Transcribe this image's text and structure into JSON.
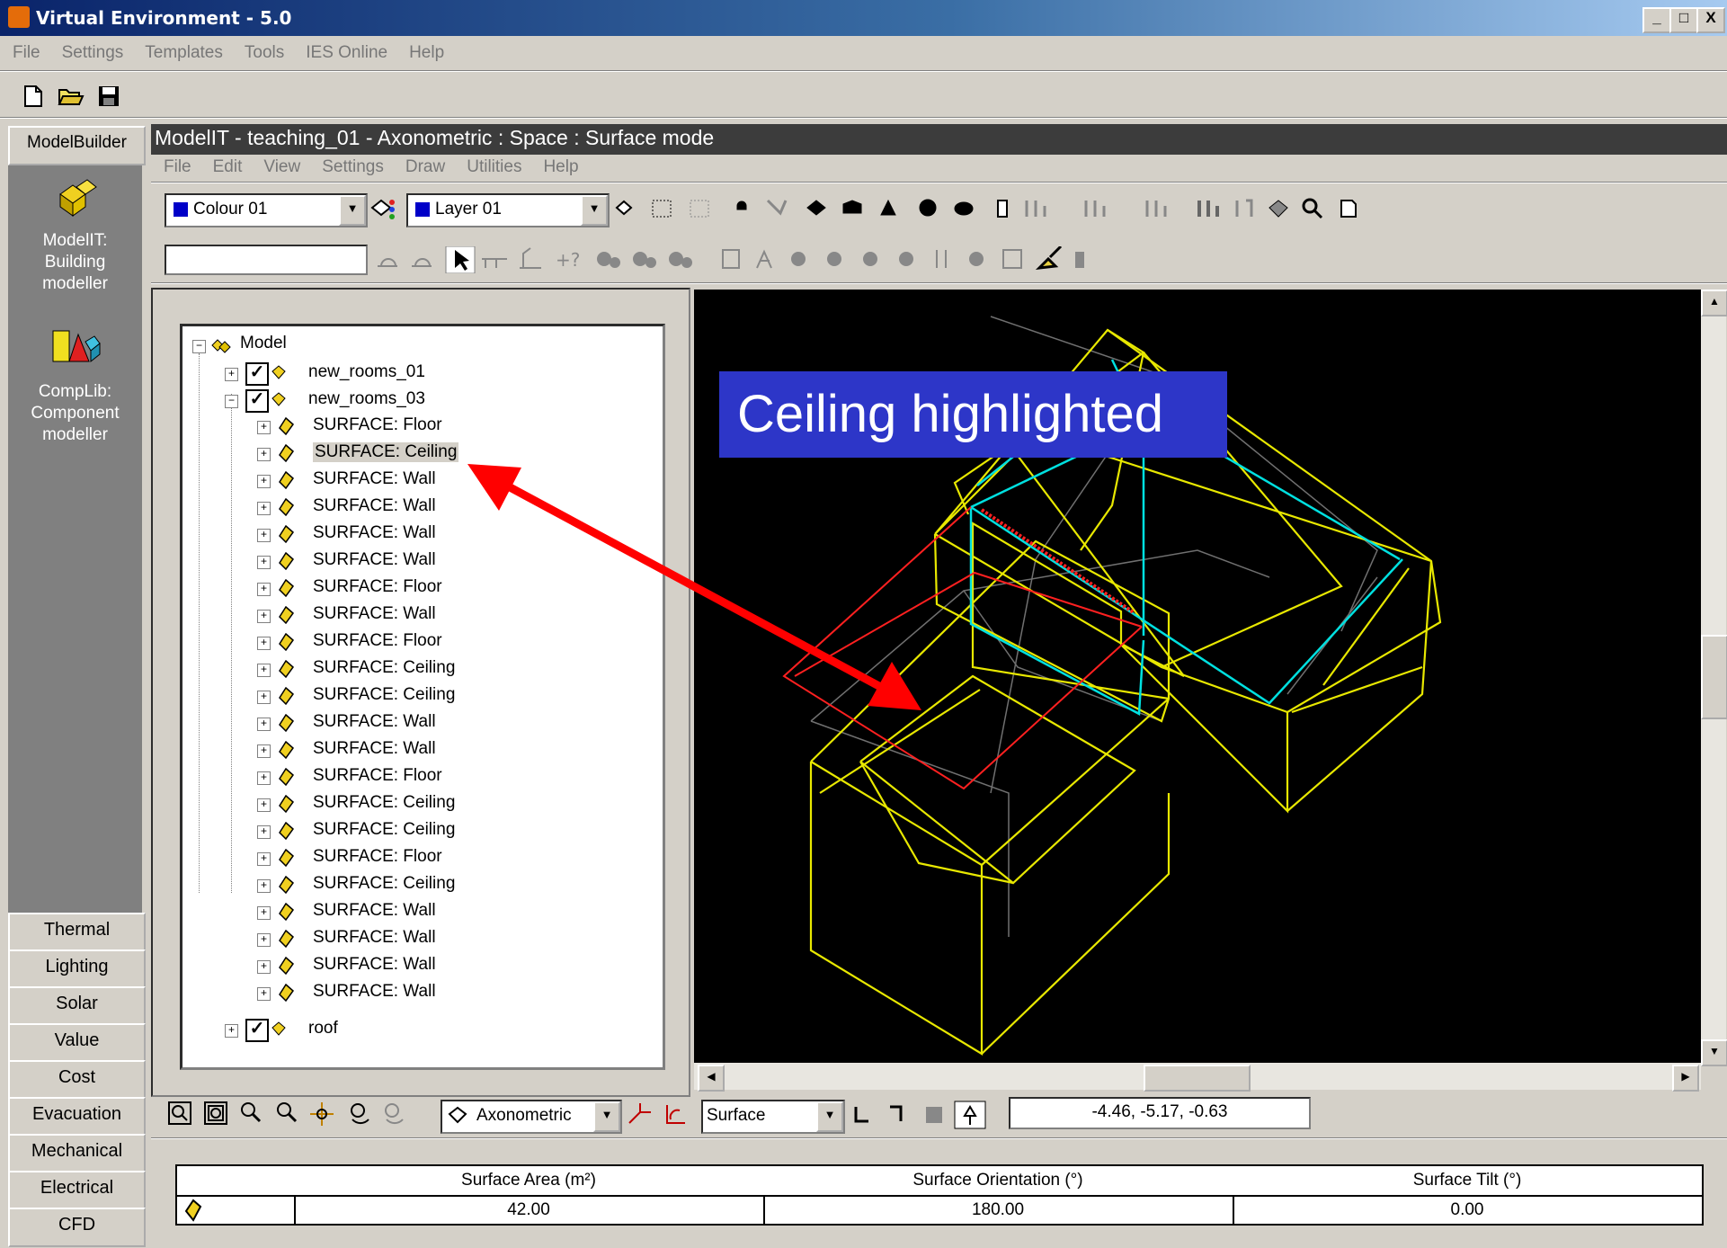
{
  "app": {
    "title": "Virtual Environment - 5.0",
    "menu": [
      "File",
      "Settings",
      "Templates",
      "Tools",
      "IES Online",
      "Help"
    ],
    "window_buttons": [
      "_",
      "□",
      "X"
    ]
  },
  "leftnav": {
    "top_label": "ModelBuilder",
    "modules": [
      {
        "label_lines": [
          "ModelIT:",
          "Building",
          "modeller"
        ]
      },
      {
        "label_lines": [
          "CompLib:",
          "Component",
          "modeller"
        ]
      }
    ],
    "buttons": [
      "Thermal",
      "Lighting",
      "Solar",
      "Value",
      "Cost",
      "Evacuation",
      "Mechanical",
      "Electrical",
      "CFD"
    ]
  },
  "modelit": {
    "title": "ModelIT - teaching_01 - Axonometric : Space : Surface mode",
    "menu": [
      "File",
      "Edit",
      "View",
      "Settings",
      "Draw",
      "Utilities",
      "Help"
    ],
    "colour_combo": "Colour 01",
    "layer_combo": "Layer 01",
    "name_field_value": ""
  },
  "tree": {
    "root": "Model",
    "groups": [
      {
        "name": "new_rooms_01",
        "checked": true,
        "expanded": false
      },
      {
        "name": "new_rooms_03",
        "checked": true,
        "expanded": true
      },
      {
        "name": "roof",
        "checked": true,
        "expanded": false
      }
    ],
    "surfaces": [
      "SURFACE: Floor",
      "SURFACE: Ceiling",
      "SURFACE: Wall",
      "SURFACE: Wall",
      "SURFACE: Wall",
      "SURFACE: Wall",
      "SURFACE: Floor",
      "SURFACE: Wall",
      "SURFACE: Floor",
      "SURFACE: Ceiling",
      "SURFACE: Ceiling",
      "SURFACE: Wall",
      "SURFACE: Wall",
      "SURFACE: Floor",
      "SURFACE: Ceiling",
      "SURFACE: Ceiling",
      "SURFACE: Floor",
      "SURFACE: Ceiling",
      "SURFACE: Wall",
      "SURFACE: Wall",
      "SURFACE: Wall",
      "SURFACE: Wall"
    ],
    "selected_index": 1
  },
  "viewport": {
    "callout": "Ceiling highlighted"
  },
  "bottombar": {
    "view_combo": "Axonometric",
    "mode_combo": "Surface",
    "coordinates": "-4.46,  -5.17,  -0.63"
  },
  "table": {
    "headers": [
      "",
      "Surface Area (m²)",
      "Surface Orientation (°)",
      "Surface Tilt (°)"
    ],
    "row": [
      "",
      "42.00",
      "180.00",
      "0.00"
    ]
  },
  "colors": {
    "titlebar": "#0a246a",
    "callout": "#2d36c8",
    "highlight_arrow": "#ff0000",
    "model_lines": "#e8e800",
    "selected_lines": "#00e0e0"
  }
}
